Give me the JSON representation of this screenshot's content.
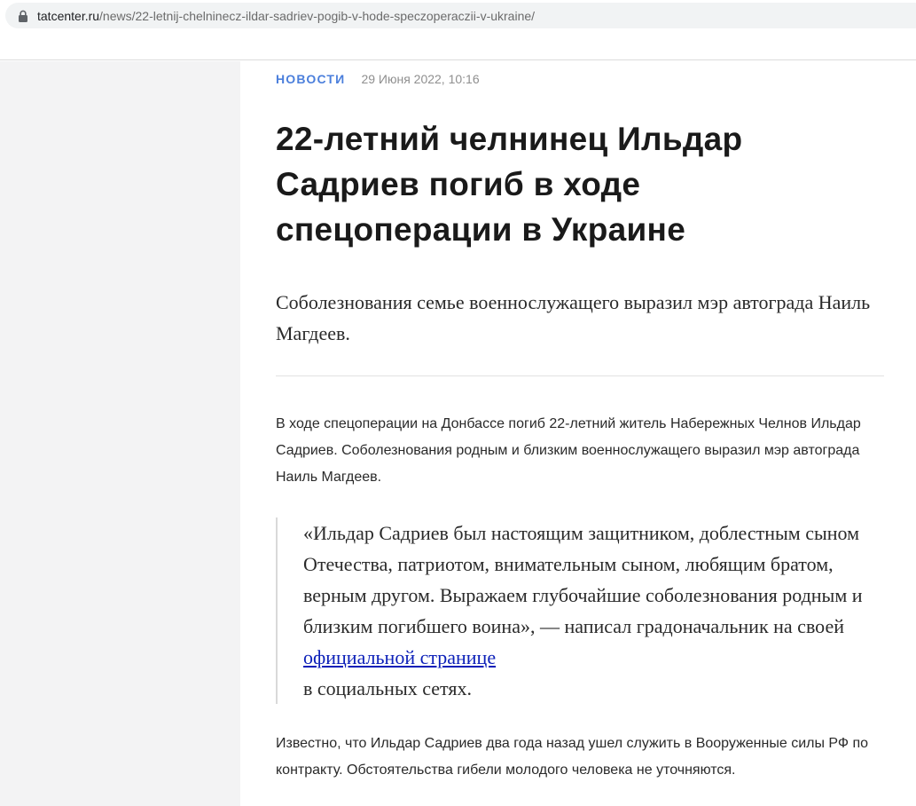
{
  "browser": {
    "url_domain": "tatcenter.ru",
    "url_path": "/news/22-letnij-chelninecz-ildar-sadriev-pogib-v-hode-speczoperaczii-v-ukraine/"
  },
  "article": {
    "rubric": "НОВОСТИ",
    "date": "29 Июня 2022, 10:16",
    "headline": "22-летний челнинец Ильдар Садриев погиб в ходе спецоперации в Украине",
    "lead": "Соболезнования семье военнослужащего выразил мэр автограда Наиль Магдеев.",
    "paragraph1": "В ходе спецоперации на Донбассе погиб 22-летний житель Набережных Челнов Ильдар Садриев. Соболезнования родным и близким военнослужащего выразил мэр автограда Наиль Магдеев.",
    "quote_text": "«Ильдар Садриев был настоящим защитником, доблестным сыном Отечества, патриотом, внимательным сыном, любящим братом, верным другом. Выражаем глубочайшие соболезнования родным и близким погибшего воина», — написал градоначальник на своей ",
    "quote_link": "официальной странице",
    "quote_tail": " в социальных сетях.",
    "paragraph2": "Известно, что Ильдар Садриев два года назад ушел служить в Вооруженные силы РФ по контракту. Обстоятельства гибели молодого человека не уточняются."
  },
  "colors": {
    "rubric": "#4b7fdc",
    "link": "#0b1fb8",
    "sidebar_bg": "#f3f3f4"
  },
  "icons": {
    "address_bar": "lock-icon"
  }
}
